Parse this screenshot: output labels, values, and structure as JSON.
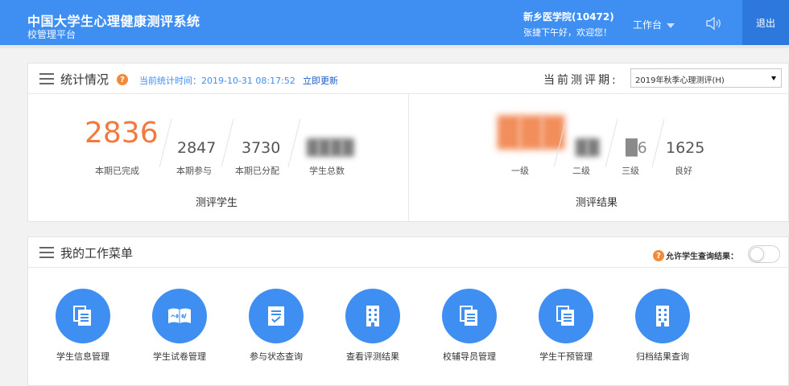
{
  "header": {
    "title": "中国大学生心理健康测评系统",
    "subtitle": "校管理平台",
    "school": "新乡医学院(10472)",
    "greeting": "张捷下午好，欢迎您！",
    "workbench_label": "工作台",
    "logout_label": "退出"
  },
  "stats": {
    "title": "统计情况",
    "help_glyph": "?",
    "time_text": "当前统计时间：2019-10-31 08:17:52",
    "update_label": "立即更新",
    "period_label": "当前测评期:",
    "period_value": "2019年秋季心理测评(H)",
    "students": {
      "caption": "测评学生",
      "completed": {
        "value": "2836",
        "label": "本期已完成"
      },
      "participated": {
        "value": "2847",
        "label": "本期参与"
      },
      "assigned": {
        "value": "3730",
        "label": "本期已分配"
      },
      "total": {
        "value": "████",
        "label": "学生总数"
      }
    },
    "results": {
      "caption": "测评结果",
      "level1": {
        "value": "███",
        "label": "一级"
      },
      "level2": {
        "value": "██",
        "label": "二级"
      },
      "level3": {
        "value": "█6",
        "label": "三级"
      },
      "good": {
        "value": "1625",
        "label": "良好"
      }
    }
  },
  "menu": {
    "title": "我的工作菜单",
    "help_glyph": "?",
    "toggle_label": "允许学生查询结果：",
    "items": [
      {
        "label": "学生信息管理",
        "icon": "document-stack-icon"
      },
      {
        "label": "学生试卷管理",
        "icon": "score-book-icon"
      },
      {
        "label": "参与状态查询",
        "icon": "checklist-icon"
      },
      {
        "label": "查看评测结果",
        "icon": "building-icon"
      },
      {
        "label": "校辅导员管理",
        "icon": "document-stack-icon"
      },
      {
        "label": "学生干预管理",
        "icon": "document-stack-icon"
      },
      {
        "label": "归档结果查询",
        "icon": "building-icon"
      }
    ]
  },
  "colors": {
    "brand": "#3f8ef2",
    "accent_orange": "#f07a3f",
    "link": "#1e5bc6"
  }
}
